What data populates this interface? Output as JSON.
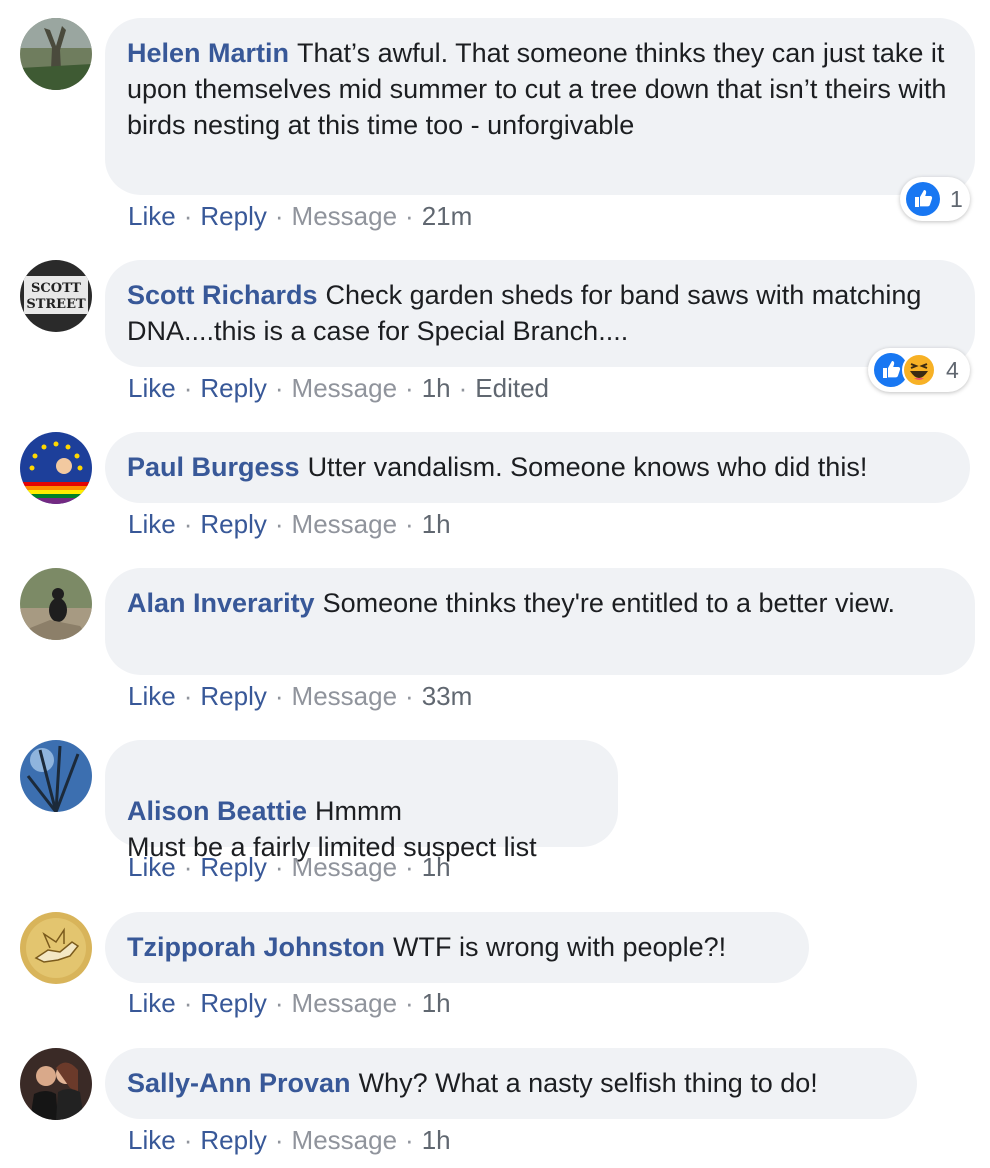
{
  "colors": {
    "author": "#385898",
    "bubble": "#f0f2f5",
    "meta": "#90949c"
  },
  "action_labels": {
    "like": "Like",
    "reply": "Reply",
    "message": "Message",
    "dot": "·"
  },
  "comments": [
    {
      "author": "Helen Martin",
      "text": "That’s awful. That someone thinks they can just take it upon themselves mid summer to cut a tree down that isn’t theirs with birds nesting at this time too - unforgivable",
      "time": "21m",
      "edited": "",
      "reaction_icons": [
        "like-icon"
      ],
      "reaction_count": "1"
    },
    {
      "author": "Scott Richards",
      "text": "Check garden sheds for band saws with matching DNA....this is a case for Special Branch....",
      "time": "1h",
      "edited": "Edited",
      "reaction_icons": [
        "like-icon",
        "haha-icon"
      ],
      "reaction_count": "4",
      "avatar_text": [
        "SCOTT",
        "STREET"
      ]
    },
    {
      "author": "Paul Burgess",
      "text": "Utter vandalism. Someone knows who did this!",
      "time": "1h",
      "edited": ""
    },
    {
      "author": "Alan Inverarity",
      "text": "Someone thinks they're entitled to a better view.",
      "time": "33m",
      "edited": ""
    },
    {
      "author": "Alison Beattie",
      "text": "Hmmm\nMust be a fairly limited suspect list",
      "time": "1h",
      "edited": ""
    },
    {
      "author": "Tzipporah Johnston",
      "text": "WTF is wrong with people?!",
      "time": "1h",
      "edited": ""
    },
    {
      "author": "Sally-Ann Provan",
      "text": "Why? What a nasty selfish thing to do!",
      "time": "1h",
      "edited": ""
    }
  ]
}
